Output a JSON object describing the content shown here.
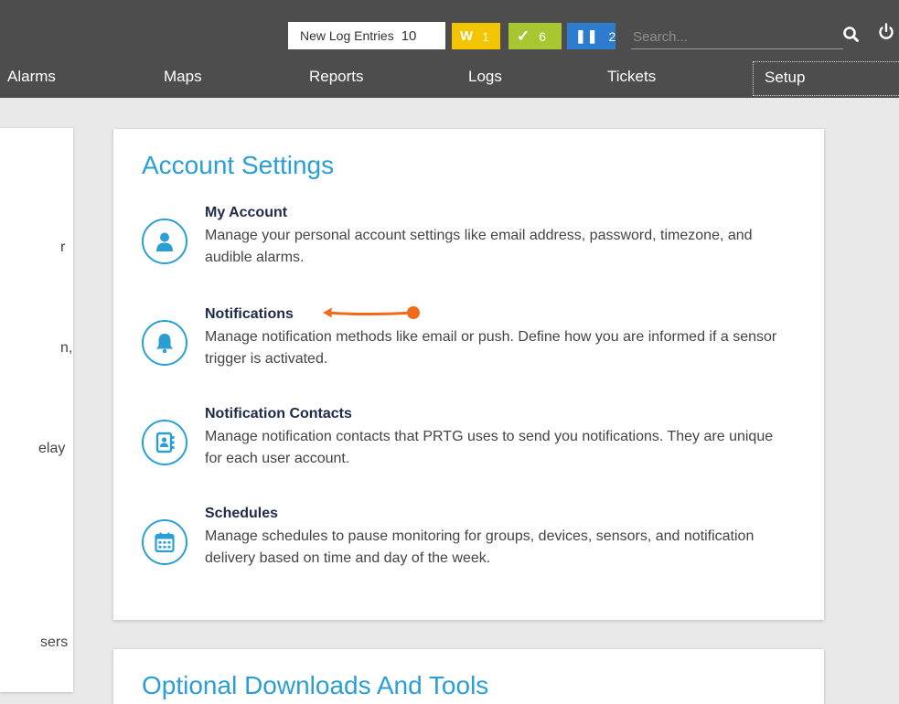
{
  "header": {
    "log_entries_label": "New Log Entries",
    "log_entries_count": "10",
    "warning_badge": {
      "label": "W",
      "count": "1",
      "color": "#f3c400"
    },
    "ok_badge": {
      "label": "✓",
      "count": "6",
      "color": "#a8c632"
    },
    "paused_badge": {
      "label": "❚❚",
      "count": "2",
      "color": "#2d7ccf"
    },
    "search_placeholder": "Search...",
    "search_icon": "search-icon",
    "power_icon": "power-icon"
  },
  "nav": {
    "items": [
      "Alarms",
      "Maps",
      "Reports",
      "Logs",
      "Tickets",
      "Setup"
    ],
    "active": "Setup"
  },
  "left_panel": {
    "fragments": [
      "r",
      "n,",
      "elay",
      "sers"
    ]
  },
  "account_settings": {
    "title": "Account Settings",
    "items": [
      {
        "name": "My Account",
        "description": "Manage your personal account settings like email address, password, timezone, and audible alarms.",
        "icon": "user-icon"
      },
      {
        "name": "Notifications",
        "description": "Manage notification methods like email or push. Define how you are informed if a sensor trigger is activated.",
        "icon": "bell-icon"
      },
      {
        "name": "Notification Contacts",
        "description": "Manage notification contacts that PRTG uses to send you notifications. They are unique for each user account.",
        "icon": "contact-book-icon"
      },
      {
        "name": "Schedules",
        "description": "Manage schedules to pause monitoring for groups, devices, sensors, and notification delivery based on time and day of the week.",
        "icon": "calendar-icon"
      }
    ]
  },
  "optional_downloads": {
    "title": "Optional Downloads And Tools"
  },
  "colors": {
    "accent": "#2a9fd6",
    "topbar": "#4d4d4d",
    "annotation_arrow": "#f06a1a"
  }
}
